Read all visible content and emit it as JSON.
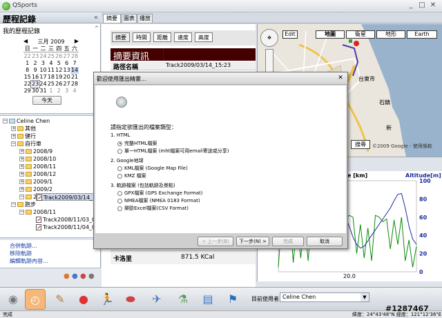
{
  "app": {
    "title": "QSports",
    "window_buttons": [
      "_",
      "□",
      "✕"
    ]
  },
  "left": {
    "title": "歷程記錄",
    "subtitle": "我的歷程記錄",
    "calendar": {
      "month": "三月 2009",
      "dow": [
        "日",
        "一",
        "二",
        "三",
        "四",
        "五",
        "六"
      ],
      "weeks": [
        [
          "22",
          "23",
          "24",
          "25",
          "26",
          "27",
          "28"
        ],
        [
          "1",
          "2",
          "3",
          "4",
          "5",
          "6",
          "7"
        ],
        [
          "8",
          "9",
          "10",
          "11",
          "12",
          "13",
          "14"
        ],
        [
          "15",
          "16",
          "17",
          "18",
          "19",
          "20",
          "21"
        ],
        [
          "22",
          "23",
          "24",
          "25",
          "26",
          "27",
          "28"
        ],
        [
          "29",
          "30",
          "31",
          "1",
          "2",
          "3",
          "4"
        ]
      ],
      "today_label": "今天"
    },
    "tree": {
      "root": "Celine Chen",
      "other": "其他",
      "hike": "健行",
      "bike": "自行車",
      "bike_months": [
        "2008/9",
        "2008/10",
        "2008/11",
        "2008/12",
        "2009/1",
        "2009/2",
        "2009/3"
      ],
      "bike_track": "Track2009/03/14_15:23",
      "run": "跑步",
      "run_month": "2008/11",
      "run_tracks": [
        "Track2008/11/03_09:0",
        "Track2008/11/04_09:2"
      ]
    },
    "links": [
      "合併軌跡...",
      "移除軌跡",
      "編輯軌跡內容..."
    ]
  },
  "tabs": [
    "摘要",
    "圖表",
    "播放"
  ],
  "summary": {
    "subtabs": [
      "摘要",
      "時間",
      "距離",
      "速度",
      "高度"
    ],
    "header": "摘要資訊",
    "row1_label": "路徑名稱",
    "row1_value": "Track2009/03/14_15:23",
    "row2_label": "卡洛里",
    "row2_value": "871.5 KCal"
  },
  "map": {
    "edit": "Edit",
    "types": [
      "地圖",
      "衛星",
      "地形",
      "Earth"
    ],
    "search": "搜尋",
    "copyright": "©2009 Google - 使用條款",
    "labels": [
      "台東市",
      "石鎮",
      "新"
    ]
  },
  "chart_data": {
    "type": "line",
    "title": "",
    "xlabel": "",
    "left_axis_label": "e [km]",
    "right_axis_label": "Altitude[m]",
    "x_tick": "20.0",
    "right_ticks": [
      "100",
      "80",
      "60",
      "40",
      "20",
      "0"
    ],
    "ylim_right": [
      0,
      100
    ],
    "series": [
      {
        "values": [
          5,
          62,
          50,
          70,
          10,
          55,
          15,
          58,
          12,
          64,
          44,
          88,
          70,
          60,
          45,
          65,
          40,
          55,
          58,
          62,
          60,
          20,
          52,
          15,
          48,
          12,
          62,
          60,
          55,
          58,
          25,
          57,
          30,
          60,
          12,
          35,
          5,
          28
        ]
      },
      {
        "values": [
          30,
          32,
          45,
          60,
          70,
          68,
          58,
          50,
          46,
          48,
          52,
          55,
          50,
          44,
          40,
          38,
          42,
          55,
          60,
          50,
          38,
          30,
          26,
          28,
          34,
          40,
          46,
          52,
          58,
          64,
          70,
          78,
          85,
          86,
          70,
          50,
          36,
          30
        ]
      }
    ]
  },
  "dialog": {
    "title": "歡迎使用匯出精靈...",
    "prompt": "請指定欲匯出的檔案類型：",
    "groups": [
      {
        "label": "1. HTML",
        "options": [
          "完整HTML檔案",
          "單一HTML檔案 (mht檔案可用email寄送或分享)"
        ]
      },
      {
        "label": "2. Google地球",
        "options": [
          "KML檔案 (Google Map File)",
          "KMZ 檔案"
        ]
      },
      {
        "label": "3. 軌跡檔案 (包括軌跡及景點)",
        "options": [
          "GPX檔案 (GPS Exchange Format)",
          "NMEA檔案 (NMEA 0183 Format)",
          "樂歐Excel檔案(CSV Format)"
        ]
      }
    ],
    "buttons": {
      "back": "< 上一步(B)",
      "next": "下一步(N) >",
      "finish": "完成",
      "cancel": "取消"
    }
  },
  "bottom": {
    "tools": [
      "disc-icon",
      "clock-icon",
      "notepad-icon",
      "apple-icon",
      "runner-icon",
      "shoe-icon",
      "satellite-icon",
      "flask-icon",
      "chart-book-icon",
      "gps-person-icon"
    ],
    "user_label": "目前使用者:",
    "user_value": "Celine Chen"
  },
  "status": {
    "left": "完成",
    "coords": "緯度：24°43'48\"N   經度：121°12'36\"E",
    "watermark": "#1287467"
  }
}
